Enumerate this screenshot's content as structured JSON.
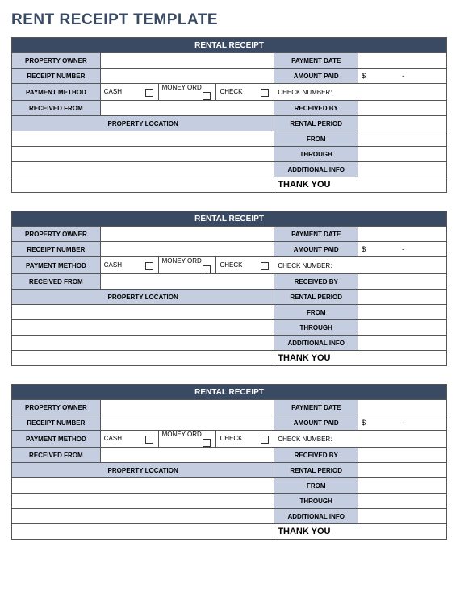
{
  "page_title": "RENT RECEIPT TEMPLATE",
  "receipt": {
    "header": "RENTAL RECEIPT",
    "labels": {
      "property_owner": "PROPERTY OWNER",
      "payment_date": "PAYMENT DATE",
      "receipt_number": "RECEIPT NUMBER",
      "amount_paid": "AMOUNT PAID",
      "payment_method": "PAYMENT METHOD",
      "received_from": "RECEIVED FROM",
      "received_by": "RECEIVED BY",
      "property_location": "PROPERTY LOCATION",
      "rental_period": "RENTAL PERIOD",
      "from": "FROM",
      "through": "THROUGH",
      "additional_info": "ADDITIONAL INFO",
      "thank_you": "THANK YOU"
    },
    "payment_methods": {
      "cash": "CASH",
      "money_ord": "MONEY ORD",
      "check": "CHECK",
      "check_number": "CHECK NUMBER:"
    },
    "amount_prefix": "$",
    "amount_suffix": "-"
  }
}
